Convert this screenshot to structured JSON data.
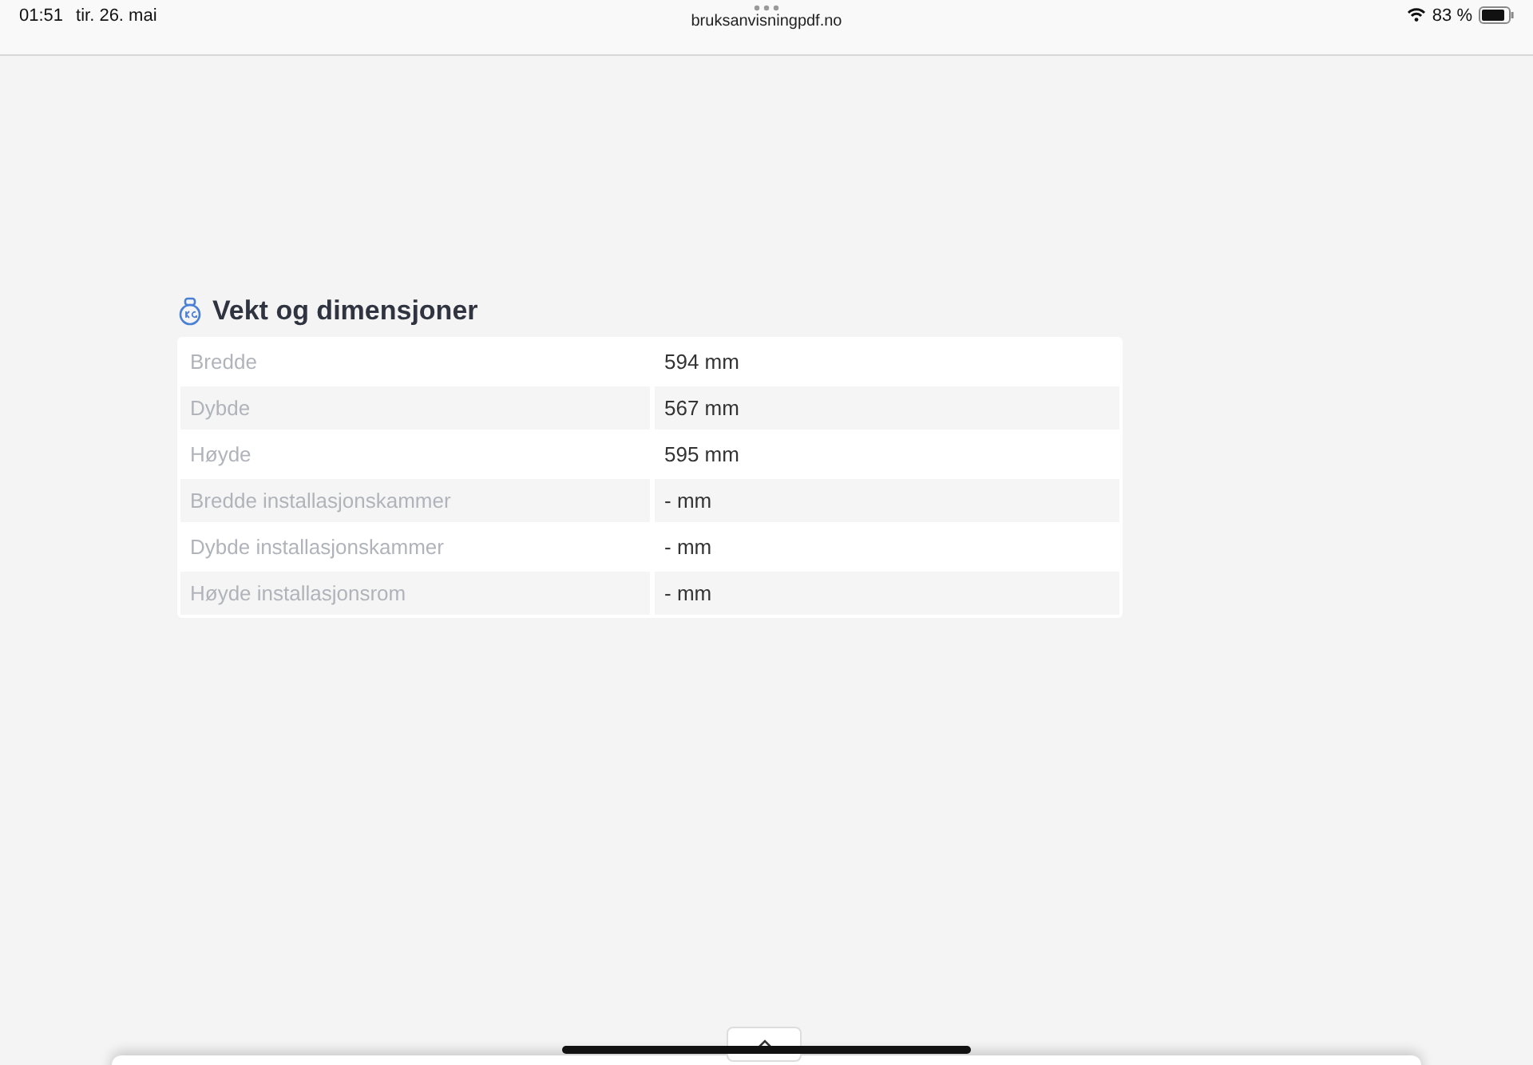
{
  "status_bar": {
    "time": "01:51",
    "date": "tir. 26. mai",
    "url": "bruksanvisningpdf.no",
    "battery": "83 %"
  },
  "section": {
    "title": "Vekt og dimensjoner",
    "rows": [
      {
        "label": "Bredde",
        "value": "594 mm"
      },
      {
        "label": "Dybde",
        "value": "567 mm"
      },
      {
        "label": "Høyde",
        "value": "595 mm"
      },
      {
        "label": "Bredde installasjonskammer",
        "value": "- mm"
      },
      {
        "label": "Dybde installasjonskammer",
        "value": "- mm"
      },
      {
        "label": "Høyde installasjonsrom",
        "value": "- mm"
      }
    ]
  }
}
